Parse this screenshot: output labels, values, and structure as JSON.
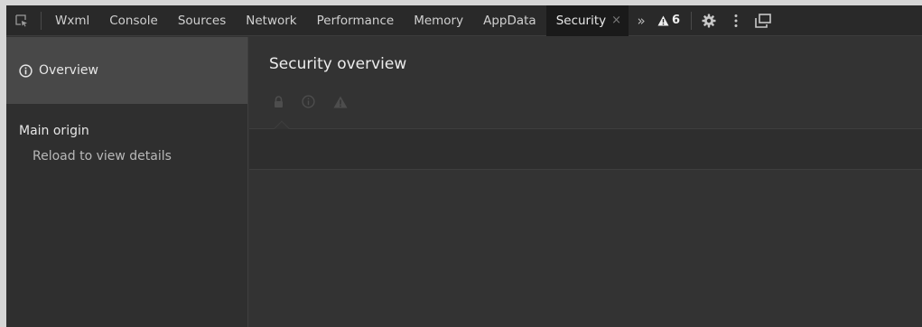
{
  "tabs": [
    {
      "label": "Wxml"
    },
    {
      "label": "Console"
    },
    {
      "label": "Sources"
    },
    {
      "label": "Network"
    },
    {
      "label": "Performance"
    },
    {
      "label": "Memory"
    },
    {
      "label": "AppData"
    },
    {
      "label": "Security",
      "active": true
    }
  ],
  "toolbar": {
    "more_tabs_glyph": "»",
    "close_glyph": "×",
    "warning_count": "6",
    "warning_icon": "warning-triangle-icon",
    "settings_icon": "gear-icon",
    "menu_icon": "kebab-menu-icon",
    "dock_icon": "undock-icon",
    "inspect_icon": "inspect-element-icon"
  },
  "sidebar": {
    "overview_label": "Overview",
    "overview_icon": "info-circle-icon",
    "main_origin_heading": "Main origin",
    "reload_hint": "Reload to view details"
  },
  "main": {
    "title": "Security overview",
    "status_icons": [
      "lock-icon",
      "info-circle-icon",
      "warning-triangle-icon"
    ]
  },
  "colors": {
    "background": "#333333",
    "sidebar_selected": "#484848",
    "tab_active": "#1a1a1a",
    "text": "#e6e6e6"
  }
}
